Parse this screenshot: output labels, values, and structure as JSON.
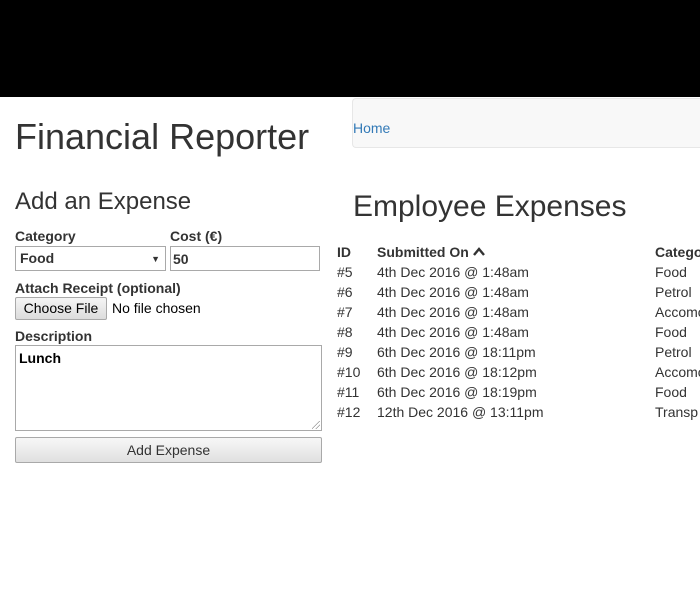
{
  "app": {
    "title": "Financial Reporter"
  },
  "nav": {
    "home_label": "Home"
  },
  "form": {
    "title": "Add an Expense",
    "category_label": "Category",
    "category_value": "Food",
    "cost_label": "Cost (€)",
    "cost_value": "50",
    "receipt_label": "Attach Receipt (optional)",
    "choose_file_label": "Choose File",
    "file_status": "No file chosen",
    "description_label": "Description",
    "description_value": "Lunch",
    "submit_label": "Add Expense"
  },
  "table": {
    "title": "Employee Expenses",
    "headers": {
      "id": "ID",
      "submitted_on": "Submitted On",
      "category": "Catego"
    },
    "rows": [
      {
        "id": "#5",
        "submitted_on": "4th Dec 2016 @ 1:48am",
        "category": "Food"
      },
      {
        "id": "#6",
        "submitted_on": "4th Dec 2016 @ 1:48am",
        "category": "Petrol"
      },
      {
        "id": "#7",
        "submitted_on": "4th Dec 2016 @ 1:48am",
        "category": "Accomo"
      },
      {
        "id": "#8",
        "submitted_on": "4th Dec 2016 @ 1:48am",
        "category": "Food"
      },
      {
        "id": "#9",
        "submitted_on": "6th Dec 2016 @ 18:11pm",
        "category": "Petrol"
      },
      {
        "id": "#10",
        "submitted_on": "6th Dec 2016 @ 18:12pm",
        "category": "Accomo"
      },
      {
        "id": "#11",
        "submitted_on": "6th Dec 2016 @ 18:19pm",
        "category": "Food"
      },
      {
        "id": "#12",
        "submitted_on": "12th Dec 2016 @ 13:11pm",
        "category": "Transp"
      }
    ]
  },
  "icons": {
    "sort": "chevron-up-icon",
    "select_caret": "caret-down-icon"
  },
  "colors": {
    "topbar": "#000000",
    "link": "#337ab7",
    "navbar_bg": "#f8f8f8"
  }
}
